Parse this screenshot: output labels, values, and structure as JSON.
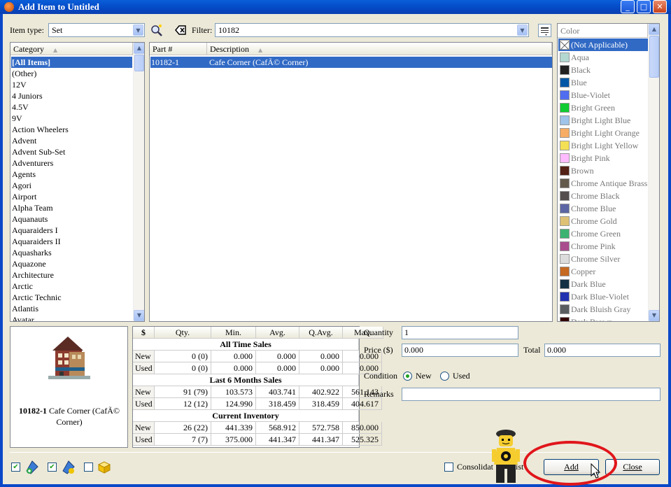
{
  "window": {
    "title": "Add Item to Untitled",
    "min": "_",
    "max": "□",
    "close": "✕"
  },
  "top": {
    "item_type_label": "Item type:",
    "item_type_value": "Set",
    "filter_label": "Filter:",
    "filter_value": "10182"
  },
  "category": {
    "header": "Category",
    "items": [
      "[All Items]",
      "(Other)",
      "12V",
      "4 Juniors",
      "4.5V",
      "9V",
      "Action Wheelers",
      "Advent",
      "Advent Sub-Set",
      "Adventurers",
      "Agents",
      "Agori",
      "Airport",
      "Alpha Team",
      "Aquanauts",
      "Aquaraiders I",
      "Aquaraiders II",
      "Aquasharks",
      "Aquazone",
      "Architecture",
      "Arctic",
      "Arctic Technic",
      "Atlantis",
      "Avatar"
    ]
  },
  "parts": {
    "col_part": "Part #",
    "col_desc": "Description",
    "rows": [
      {
        "part": "10182-1",
        "desc": "Cafe Corner (CafÃ© Corner)"
      }
    ]
  },
  "colors": {
    "header": "Color",
    "items": [
      {
        "name": "(Not Applicable)",
        "hex": "#ffffff"
      },
      {
        "name": "Aqua",
        "hex": "#b3d7d1"
      },
      {
        "name": "Black",
        "hex": "#212121"
      },
      {
        "name": "Blue",
        "hex": "#0057a6"
      },
      {
        "name": "Blue-Violet",
        "hex": "#506cef"
      },
      {
        "name": "Bright Green",
        "hex": "#10cb31"
      },
      {
        "name": "Bright Light Blue",
        "hex": "#9fc3e9"
      },
      {
        "name": "Bright Light Orange",
        "hex": "#f7ad63"
      },
      {
        "name": "Bright Light Yellow",
        "hex": "#f3e055"
      },
      {
        "name": "Bright Pink",
        "hex": "#ffbbff"
      },
      {
        "name": "Brown",
        "hex": "#532115"
      },
      {
        "name": "Chrome Antique Brass",
        "hex": "#645a4c"
      },
      {
        "name": "Chrome Black",
        "hex": "#544e4f"
      },
      {
        "name": "Chrome Blue",
        "hex": "#5c66a4"
      },
      {
        "name": "Chrome Gold",
        "hex": "#dfc176"
      },
      {
        "name": "Chrome Green",
        "hex": "#3cb371"
      },
      {
        "name": "Chrome Pink",
        "hex": "#aa4d8e"
      },
      {
        "name": "Chrome Silver",
        "hex": "#dcdcdc"
      },
      {
        "name": "Copper",
        "hex": "#c66921"
      },
      {
        "name": "Dark Blue",
        "hex": "#143044"
      },
      {
        "name": "Dark Blue-Violet",
        "hex": "#2032b0"
      },
      {
        "name": "Dark Bluish Gray",
        "hex": "#595d60"
      },
      {
        "name": "Dark Brown",
        "hex": "#330000"
      }
    ]
  },
  "preview": {
    "part": "10182-1",
    "name": "Cafe Corner (CafÃ© Corner)"
  },
  "stats": {
    "headers": [
      "$",
      "Qty.",
      "Min.",
      "Avg.",
      "Q.Avg.",
      "Max."
    ],
    "sections": [
      {
        "title": "All Time Sales",
        "rows": [
          {
            "cond": "New",
            "qty": "0 (0)",
            "min": "0.000",
            "avg": "0.000",
            "qavg": "0.000",
            "max": "0.000"
          },
          {
            "cond": "Used",
            "qty": "0 (0)",
            "min": "0.000",
            "avg": "0.000",
            "qavg": "0.000",
            "max": "0.000"
          }
        ]
      },
      {
        "title": "Last 6 Months Sales",
        "rows": [
          {
            "cond": "New",
            "qty": "91 (79)",
            "min": "103.573",
            "avg": "403.741",
            "qavg": "402.922",
            "max": "561.143"
          },
          {
            "cond": "Used",
            "qty": "12 (12)",
            "min": "124.990",
            "avg": "318.459",
            "qavg": "318.459",
            "max": "404.617"
          }
        ]
      },
      {
        "title": "Current Inventory",
        "rows": [
          {
            "cond": "New",
            "qty": "26 (22)",
            "min": "441.339",
            "avg": "568.912",
            "qavg": "572.758",
            "max": "850.000"
          },
          {
            "cond": "Used",
            "qty": "7 (7)",
            "min": "375.000",
            "avg": "441.347",
            "qavg": "441.347",
            "max": "525.325"
          }
        ]
      }
    ]
  },
  "form": {
    "quantity_label": "Quantity",
    "quantity": "1",
    "price_label": "Price ($)",
    "price": "0.000",
    "total_label": "Total",
    "total": "0.000",
    "condition_label": "Condition",
    "cond_new": "New",
    "cond_used": "Used",
    "remarks_label": "Remarks",
    "remarks": ""
  },
  "bottom": {
    "consolidate_a": "Consolidat",
    "consolidate_b": "ist",
    "add": "Add",
    "close": "Close"
  },
  "annotation": {
    "color": "#e0161b"
  }
}
